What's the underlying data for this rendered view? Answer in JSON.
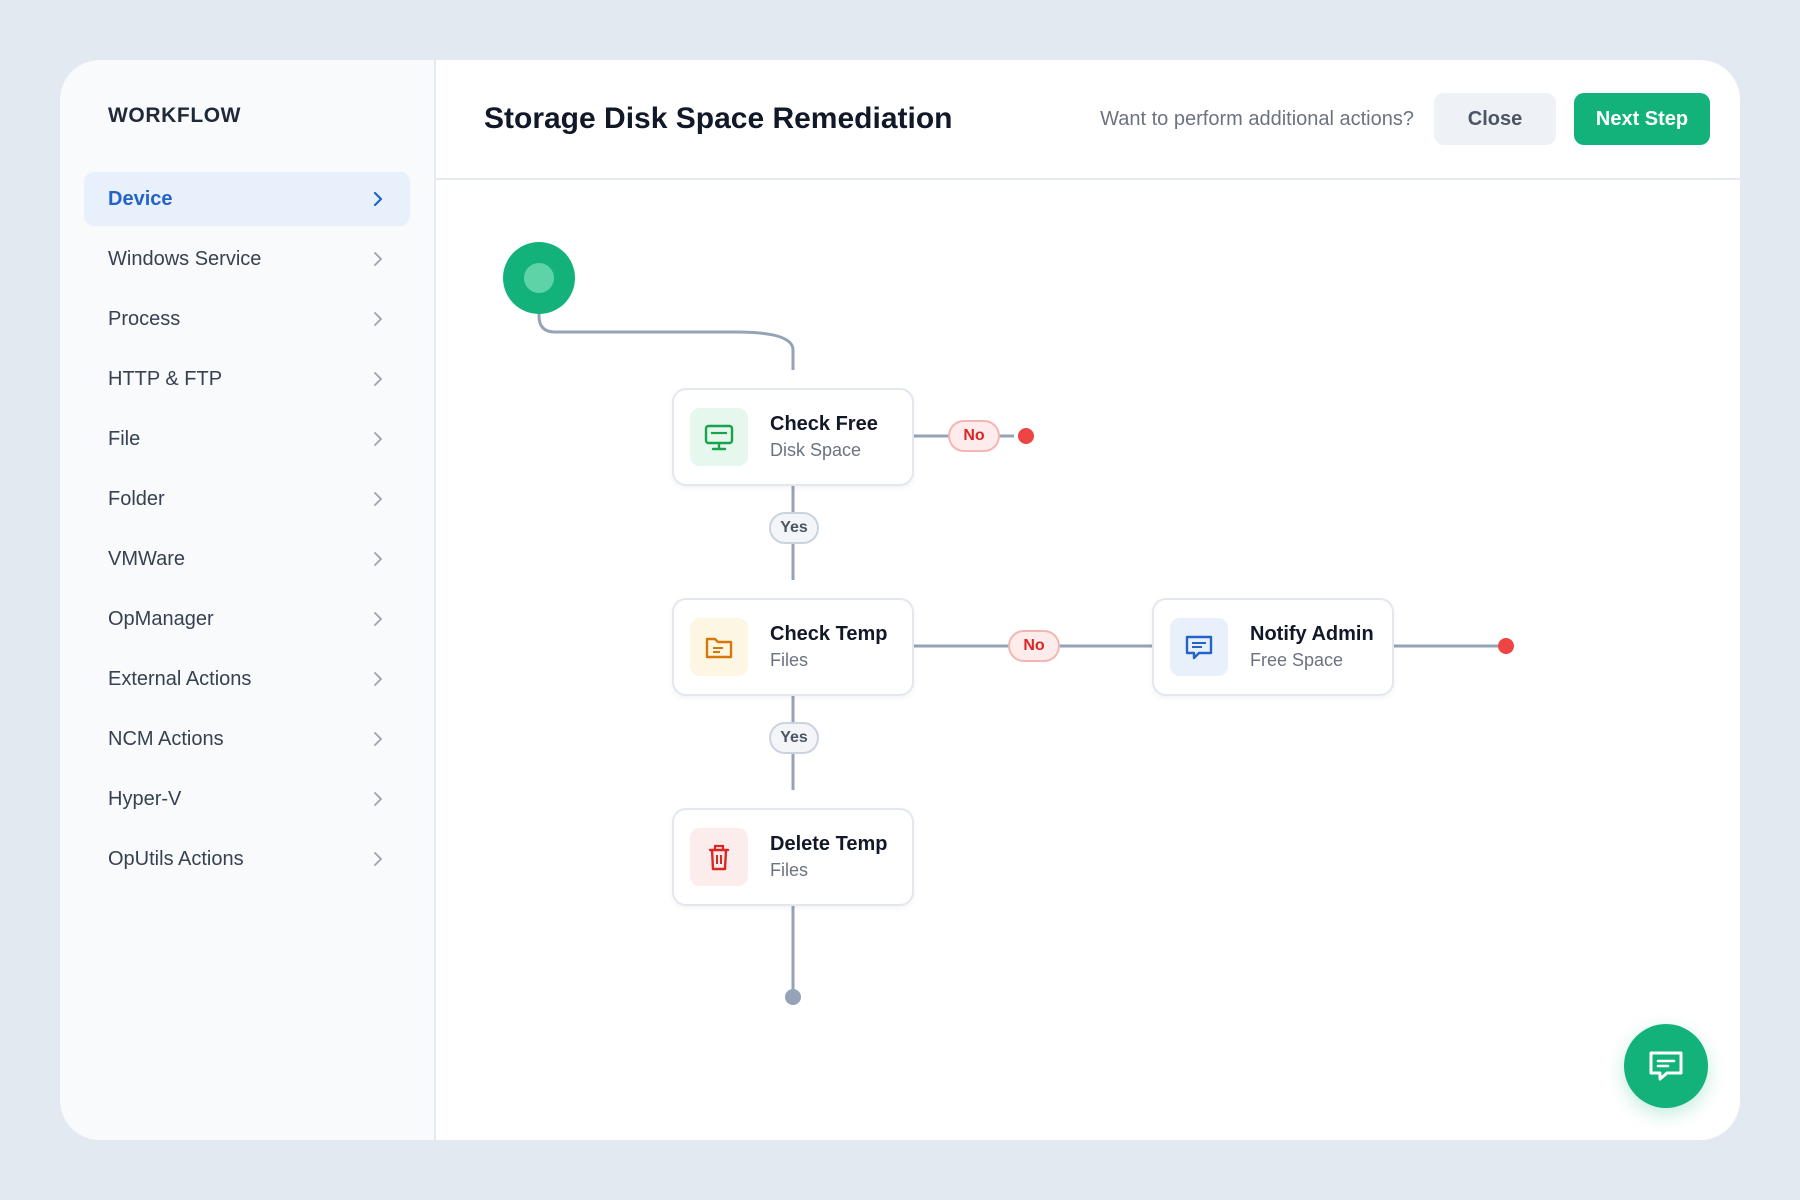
{
  "sidebar": {
    "title": "WORKFLOW",
    "items": [
      {
        "label": "Device",
        "active": true
      },
      {
        "label": "Windows Service"
      },
      {
        "label": "Process"
      },
      {
        "label": "HTTP & FTP"
      },
      {
        "label": "File"
      },
      {
        "label": "Folder"
      },
      {
        "label": "VMWare"
      },
      {
        "label": "OpManager"
      },
      {
        "label": "External Actions"
      },
      {
        "label": "NCM Actions"
      },
      {
        "label": "Hyper-V"
      },
      {
        "label": "OpUtils Actions"
      }
    ]
  },
  "header": {
    "title": "Storage Disk Space Remediation",
    "prompt": "Want to perform additional actions?",
    "close_label": "Close",
    "next_label": "Next Step"
  },
  "flow": {
    "nodes": {
      "check_free": {
        "title": "Check Free",
        "subtitle": "Disk Space",
        "icon": "monitor-icon"
      },
      "check_temp": {
        "title": "Check Temp",
        "subtitle": "Files",
        "icon": "folder-icon"
      },
      "delete_temp": {
        "title": "Delete Temp",
        "subtitle": "Files",
        "icon": "trash-icon"
      },
      "notify_admin": {
        "title": "Notify Admin",
        "subtitle": "Free Space",
        "icon": "message-icon"
      }
    },
    "labels": {
      "no1": "No",
      "yes1": "Yes",
      "no2": "No",
      "yes2": "Yes"
    }
  },
  "colors": {
    "accent": "#12b27a",
    "link": "#2563c9",
    "error": "#ef4444",
    "connector": "#94a3b8"
  },
  "fab": {
    "icon": "chat-icon"
  }
}
